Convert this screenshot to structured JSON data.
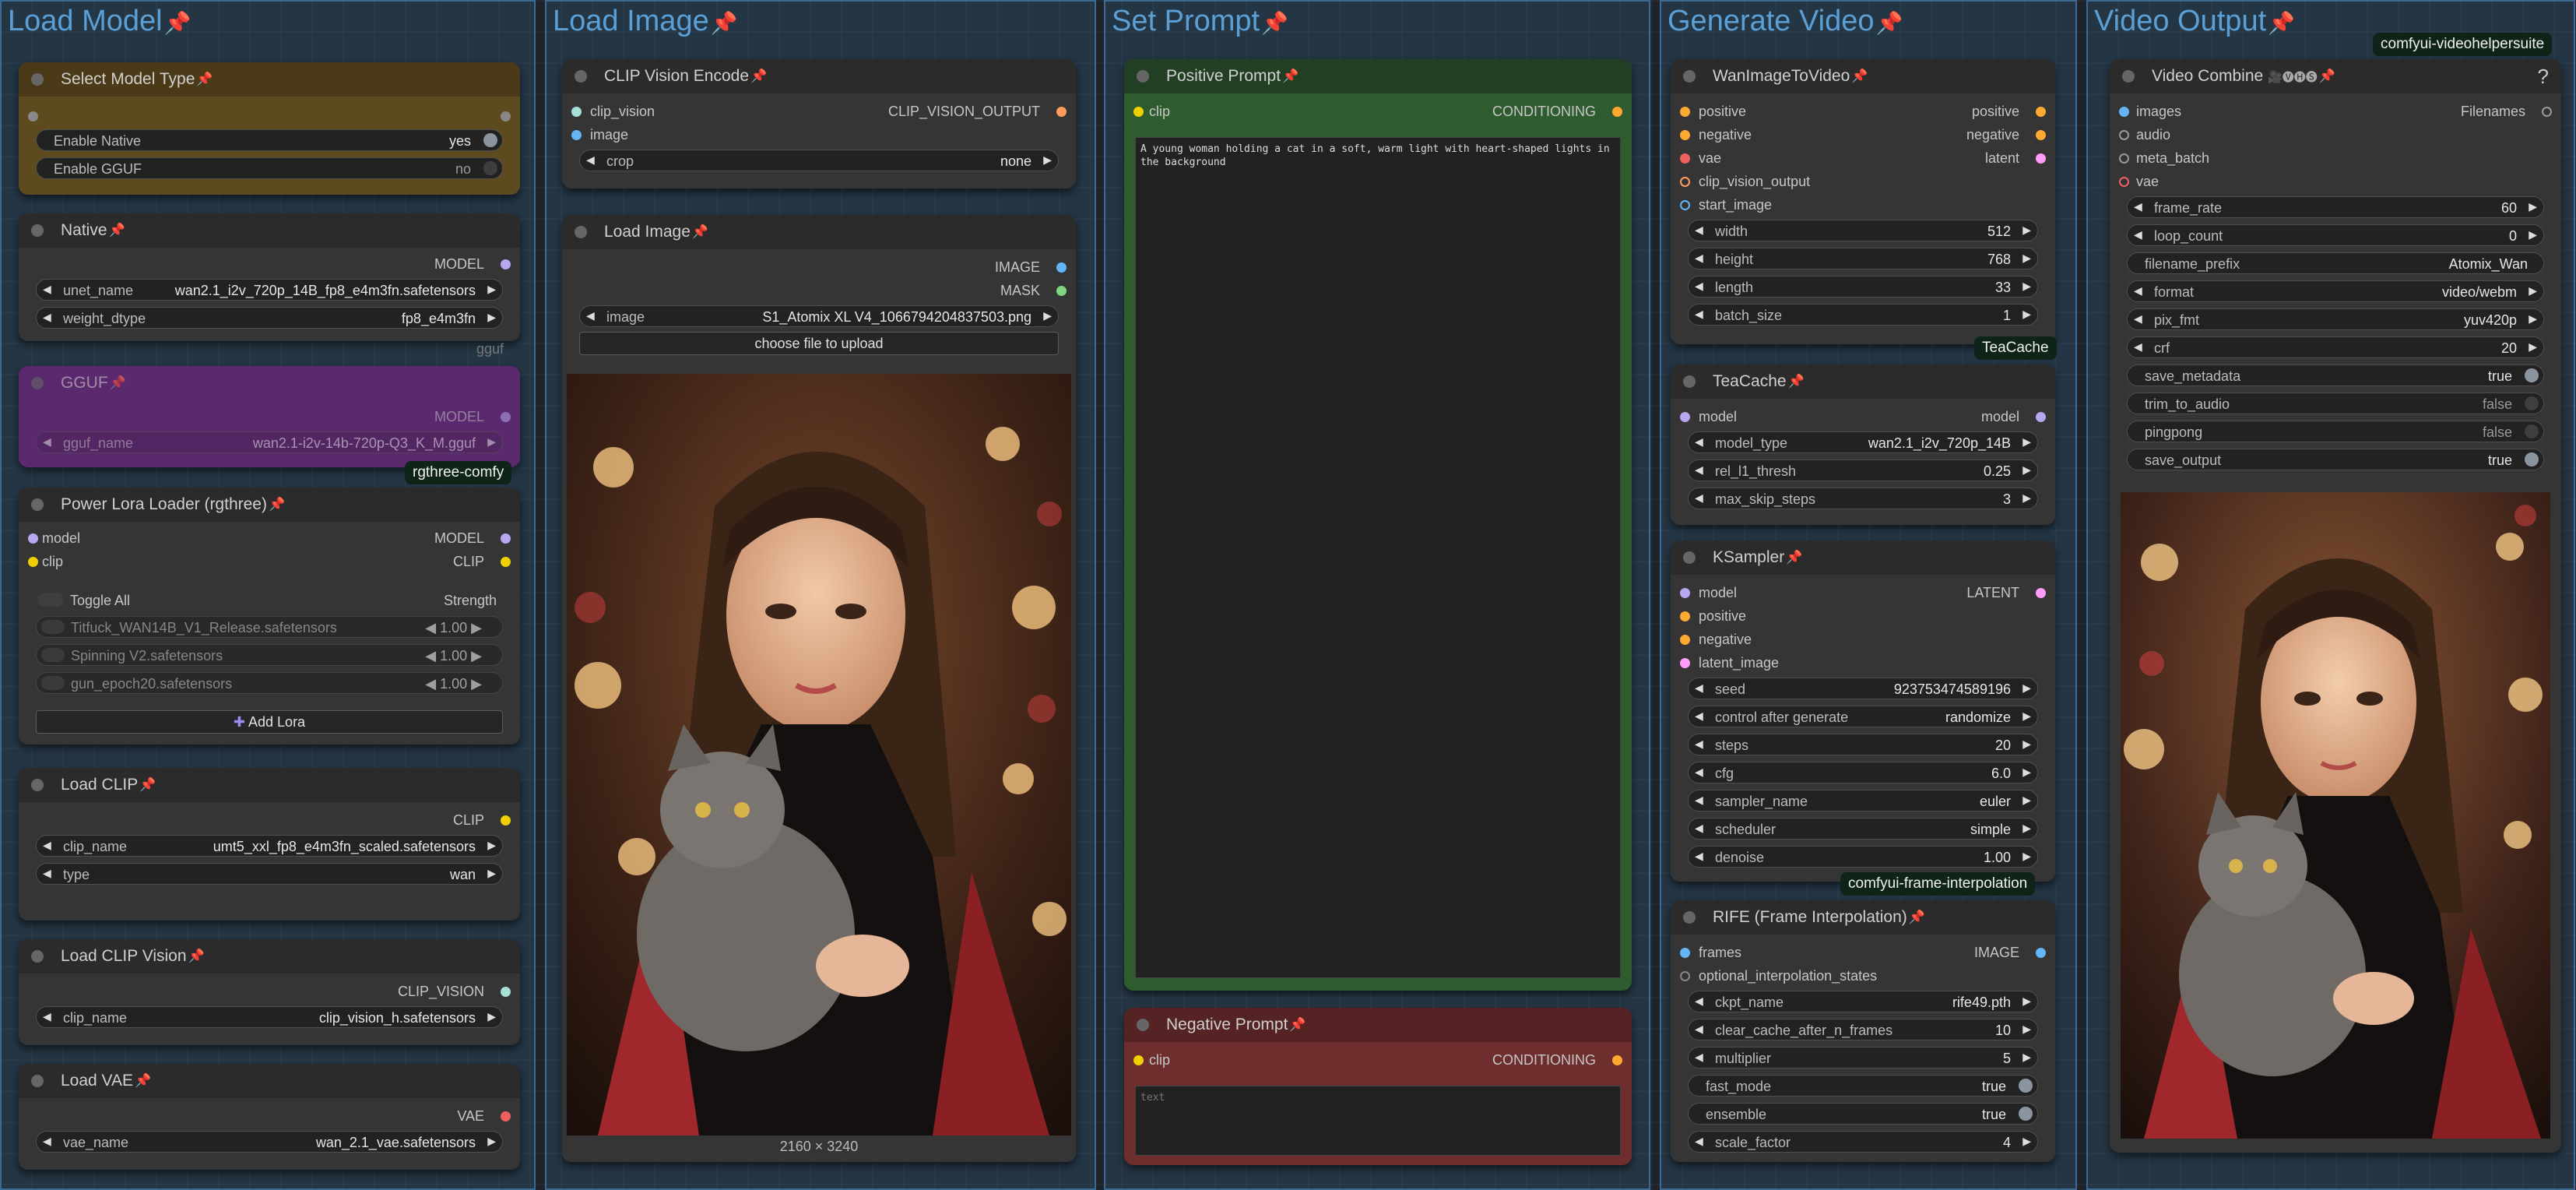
{
  "groups": [
    {
      "title": "Load Model"
    },
    {
      "title": "Load Image"
    },
    {
      "title": "Set Prompt"
    },
    {
      "title": "Generate Video"
    },
    {
      "title": "Video Output"
    }
  ],
  "select_model": {
    "title": "Select Model Type",
    "enable_native": "Enable Native",
    "enable_native_val": "yes",
    "enable_gguf": "Enable GGUF",
    "enable_gguf_val": "no"
  },
  "native": {
    "title": "Native",
    "out": "MODEL",
    "unet_label": "unet_name",
    "unet_val": "wan2.1_i2v_720p_14B_fp8_e4m3fn.safetensors",
    "wd_label": "weight_dtype",
    "wd_val": "fp8_e4m3fn",
    "badge": "gguf"
  },
  "gguf": {
    "title": "GGUF",
    "out": "MODEL",
    "label": "gguf_name",
    "val": "wan2.1-i2v-14b-720p-Q3_K_M.gguf",
    "tag": "rgthree-comfy"
  },
  "lora": {
    "title": "Power Lora Loader (rgthree)",
    "in_model": "model",
    "in_clip": "clip",
    "out_model": "MODEL",
    "out_clip": "CLIP",
    "toggle": "Toggle All",
    "strength": "Strength",
    "items": [
      {
        "name": "Titfuck_WAN14B_V1_Release.safetensors",
        "val": "1.00"
      },
      {
        "name": "Spinning V2.safetensors",
        "val": "1.00"
      },
      {
        "name": "gun_epoch20.safetensors",
        "val": "1.00"
      }
    ],
    "add": "Add Lora"
  },
  "clip": {
    "title": "Load CLIP",
    "out": "CLIP",
    "name_label": "clip_name",
    "name_val": "umt5_xxl_fp8_e4m3fn_scaled.safetensors",
    "type_label": "type",
    "type_val": "wan"
  },
  "clipvision": {
    "title": "Load CLIP Vision",
    "out": "CLIP_VISION",
    "label": "clip_name",
    "val": "clip_vision_h.safetensors"
  },
  "vae": {
    "title": "Load VAE",
    "out": "VAE",
    "label": "vae_name",
    "val": "wan_2.1_vae.safetensors"
  },
  "cve": {
    "title": "CLIP Vision Encode",
    "in1": "clip_vision",
    "in2": "image",
    "out": "CLIP_VISION_OUTPUT",
    "crop_label": "crop",
    "crop_val": "none"
  },
  "loadimg": {
    "title": "Load Image",
    "out1": "IMAGE",
    "out2": "MASK",
    "img_label": "image",
    "img_val": "S1_Atomix XL V4_1066794204837503.png",
    "upload": "choose file to upload",
    "size": "2160 × 3240"
  },
  "pos": {
    "title": "Positive Prompt",
    "in": "clip",
    "out": "CONDITIONING",
    "text": "A young woman holding a cat in a soft, warm light with heart-shaped lights in the background"
  },
  "neg": {
    "title": "Negative Prompt",
    "in": "clip",
    "out": "CONDITIONING",
    "placeholder": "text"
  },
  "wan": {
    "title": "WanImageToVideo",
    "inputs": [
      "positive",
      "negative",
      "vae",
      "clip_vision_output",
      "start_image"
    ],
    "outputs": [
      "positive",
      "negative",
      "latent"
    ],
    "widgets": [
      {
        "l": "width",
        "v": "512"
      },
      {
        "l": "height",
        "v": "768"
      },
      {
        "l": "length",
        "v": "33"
      },
      {
        "l": "batch_size",
        "v": "1"
      }
    ],
    "tag": "TeaCache"
  },
  "tea": {
    "title": "TeaCache",
    "in": "model",
    "out": "model",
    "widgets": [
      {
        "l": "model_type",
        "v": "wan2.1_i2v_720p_14B"
      },
      {
        "l": "rel_l1_thresh",
        "v": "0.25"
      },
      {
        "l": "max_skip_steps",
        "v": "3"
      }
    ]
  },
  "ks": {
    "title": "KSampler",
    "inputs": [
      "model",
      "positive",
      "negative",
      "latent_image"
    ],
    "out": "LATENT",
    "widgets": [
      {
        "l": "seed",
        "v": "923753474589196"
      },
      {
        "l": "control after generate",
        "v": "randomize"
      },
      {
        "l": "steps",
        "v": "20"
      },
      {
        "l": "cfg",
        "v": "6.0"
      },
      {
        "l": "sampler_name",
        "v": "euler"
      },
      {
        "l": "scheduler",
        "v": "simple"
      },
      {
        "l": "denoise",
        "v": "1.00"
      }
    ],
    "tag": "comfyui-frame-interpolation"
  },
  "rife": {
    "title": "RIFE (Frame Interpolation)",
    "in1": "frames",
    "in2": "optional_interpolation_states",
    "out": "IMAGE",
    "widgets": [
      {
        "l": "ckpt_name",
        "v": "rife49.pth"
      },
      {
        "l": "clear_cache_after_n_frames",
        "v": "10"
      },
      {
        "l": "multiplier",
        "v": "5"
      }
    ],
    "toggles": [
      {
        "l": "fast_mode",
        "v": "true"
      },
      {
        "l": "ensemble",
        "v": "true"
      }
    ],
    "scale_label": "scale_factor",
    "scale_val": "4"
  },
  "vc": {
    "title": "Video Combine",
    "icons": "🎥🅥🅗🅢",
    "help": "?",
    "tag": "comfyui-videohelpersuite",
    "inputs": [
      "images",
      "audio",
      "meta_batch",
      "vae"
    ],
    "out": "Filenames",
    "widgets": [
      {
        "l": "frame_rate",
        "v": "60"
      },
      {
        "l": "loop_count",
        "v": "0"
      }
    ],
    "prefix_label": "filename_prefix",
    "prefix_val": "Atomix_Wan",
    "widgets2": [
      {
        "l": "format",
        "v": "video/webm"
      },
      {
        "l": "pix_fmt",
        "v": "yuv420p"
      },
      {
        "l": "crf",
        "v": "20"
      }
    ],
    "toggles": [
      {
        "l": "save_metadata",
        "v": "true",
        "on": true
      },
      {
        "l": "trim_to_audio",
        "v": "false",
        "on": false
      },
      {
        "l": "pingpong",
        "v": "false",
        "on": false
      },
      {
        "l": "save_output",
        "v": "true",
        "on": true
      }
    ]
  },
  "colors": {
    "group_bg": "#2e4a63",
    "group_border": "#3c6a92",
    "title": "#5aa0d6",
    "node": "#353535",
    "pos": "#2f5c2f",
    "neg": "#6e2e2e",
    "select": "#5e4a1f",
    "gguf": "#5b2a6e"
  },
  "icons": {
    "pin": "pushpin-icon",
    "plus": "plus-icon",
    "arrows": "triangle-arrow-icon"
  }
}
